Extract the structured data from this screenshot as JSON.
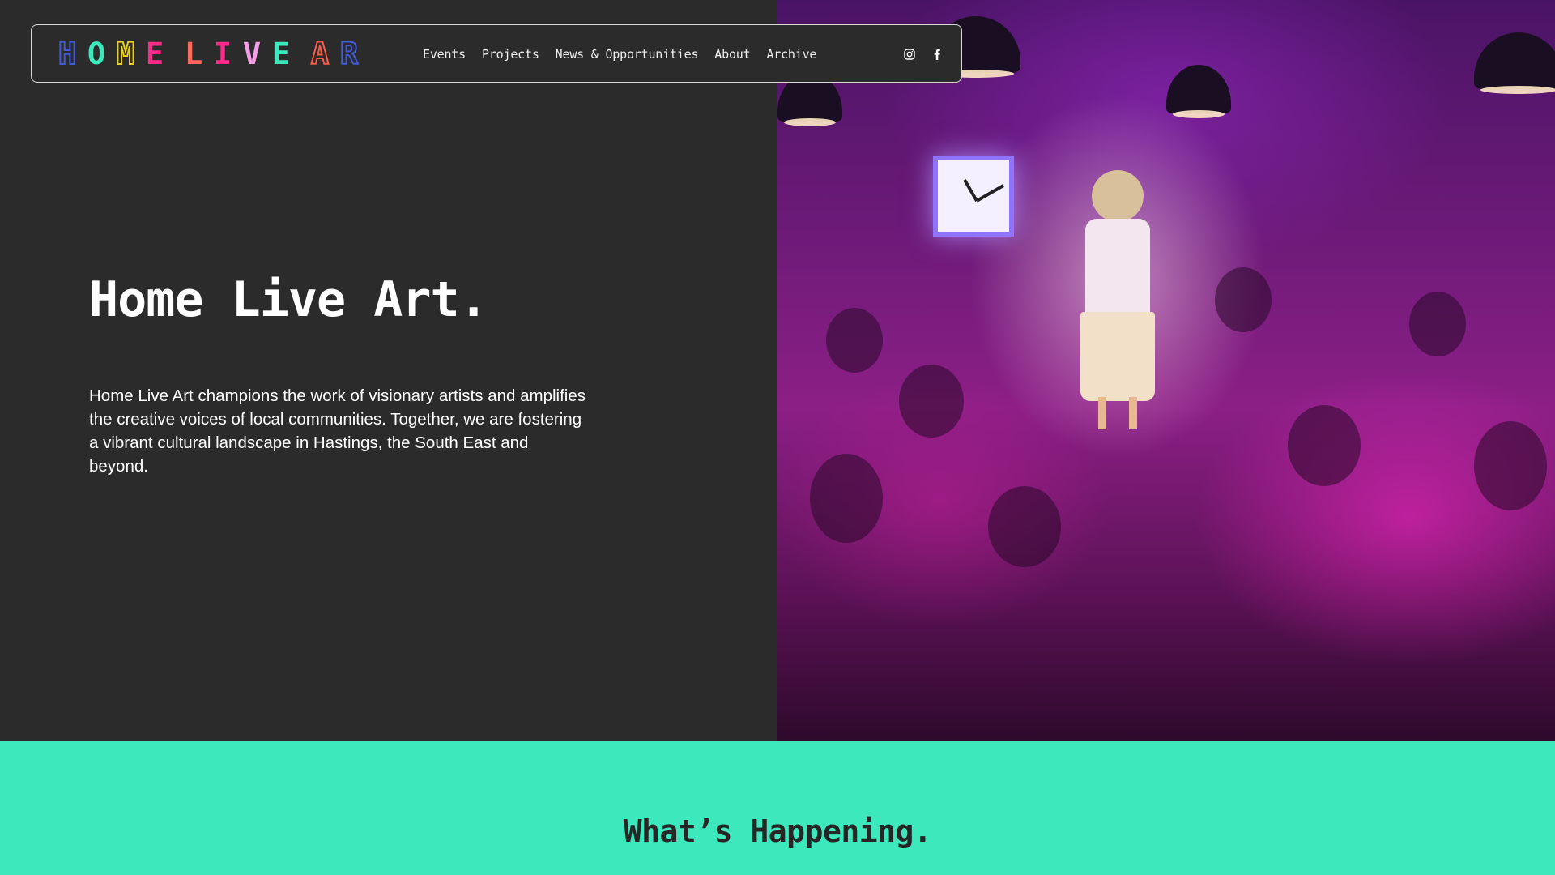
{
  "site": {
    "logo_letters": [
      {
        "char": "H",
        "color": "#3f5bd9",
        "style": "outline"
      },
      {
        "char": "O",
        "color": "#3de8bc",
        "style": "solid"
      },
      {
        "char": "M",
        "color": "#e8d020",
        "style": "outline"
      },
      {
        "char": "E",
        "color": "#ff2a8a",
        "style": "solid"
      },
      {
        "char": "L",
        "color": "#ff6a5a",
        "style": "solid"
      },
      {
        "char": "I",
        "color": "#ff2a8a",
        "style": "solid"
      },
      {
        "char": "V",
        "color": "#f59ee8",
        "style": "triangle"
      },
      {
        "char": "E",
        "color": "#3de8bc",
        "style": "solid"
      },
      {
        "char": "A",
        "color": "#ff5a4a",
        "style": "outline-triangle"
      },
      {
        "char": "R",
        "color": "#3f5bd9",
        "style": "outline"
      }
    ],
    "logo_alt": "HOME LIVE ART"
  },
  "nav": {
    "links": [
      "Events",
      "Projects",
      "News & Opportunities",
      "About",
      "Archive"
    ],
    "social": [
      {
        "icon": "instagram-icon"
      },
      {
        "icon": "facebook-icon"
      }
    ]
  },
  "hero": {
    "title": "Home Live Art.",
    "description": "Home Live Art champions the work of visionary artists and amplifies the creative voices of local communities. Together, we are fostering a vibrant cultural landscape in Hastings, the South East and beyond."
  },
  "section": {
    "title": "What’s Happening."
  },
  "colors": {
    "background": "#2b2b2b",
    "accent": "#3de8bc",
    "text": "#ffffff"
  }
}
